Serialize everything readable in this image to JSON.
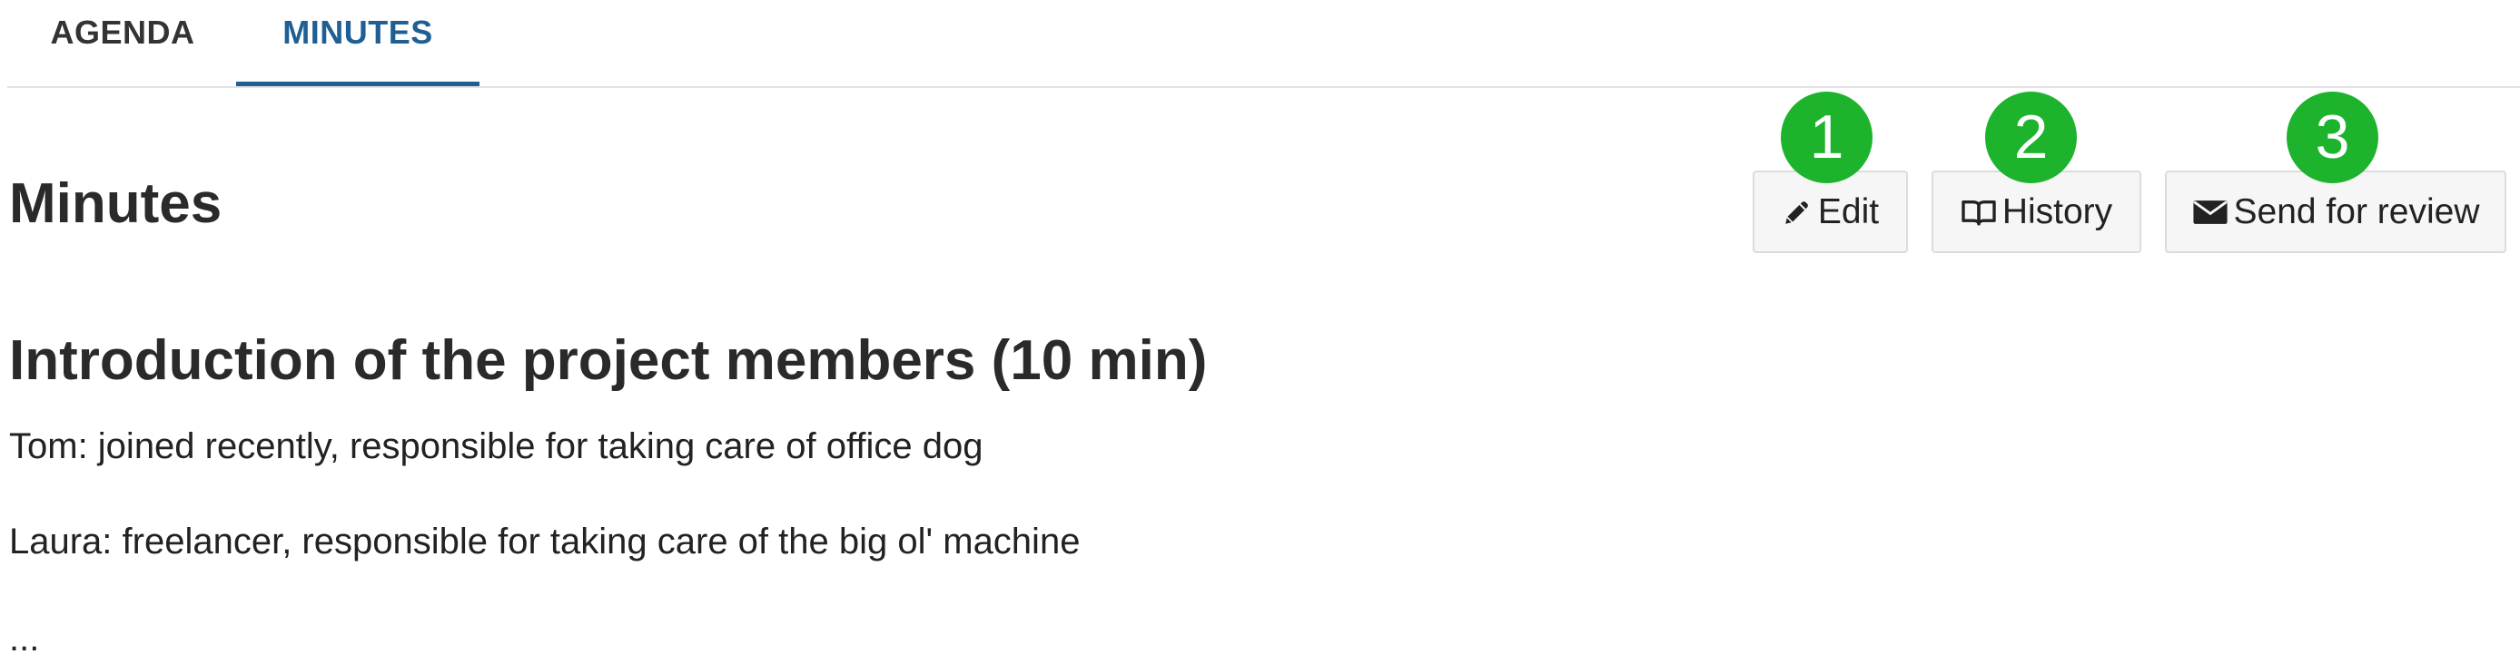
{
  "tabs": [
    {
      "label": "AGENDA",
      "active": false
    },
    {
      "label": "MINUTES",
      "active": true
    }
  ],
  "page": {
    "title": "Minutes"
  },
  "toolbar": {
    "edit_label": "Edit",
    "history_label": "History",
    "review_label": "Send for review",
    "edit_icon": "pencil-icon",
    "history_icon": "book-icon",
    "review_icon": "envelope-icon"
  },
  "markers": [
    "1",
    "2",
    "3"
  ],
  "content": {
    "heading": "Introduction of the project members (10 min)",
    "paragraphs": [
      "Tom: joined recently, responsible for taking care of office dog",
      "Laura: freelancer, responsible for taking care of the big ol' machine",
      "..."
    ]
  },
  "colors": {
    "accent": "#1f5f94",
    "marker": "#1db32d",
    "button_bg": "#f6f6f6"
  }
}
